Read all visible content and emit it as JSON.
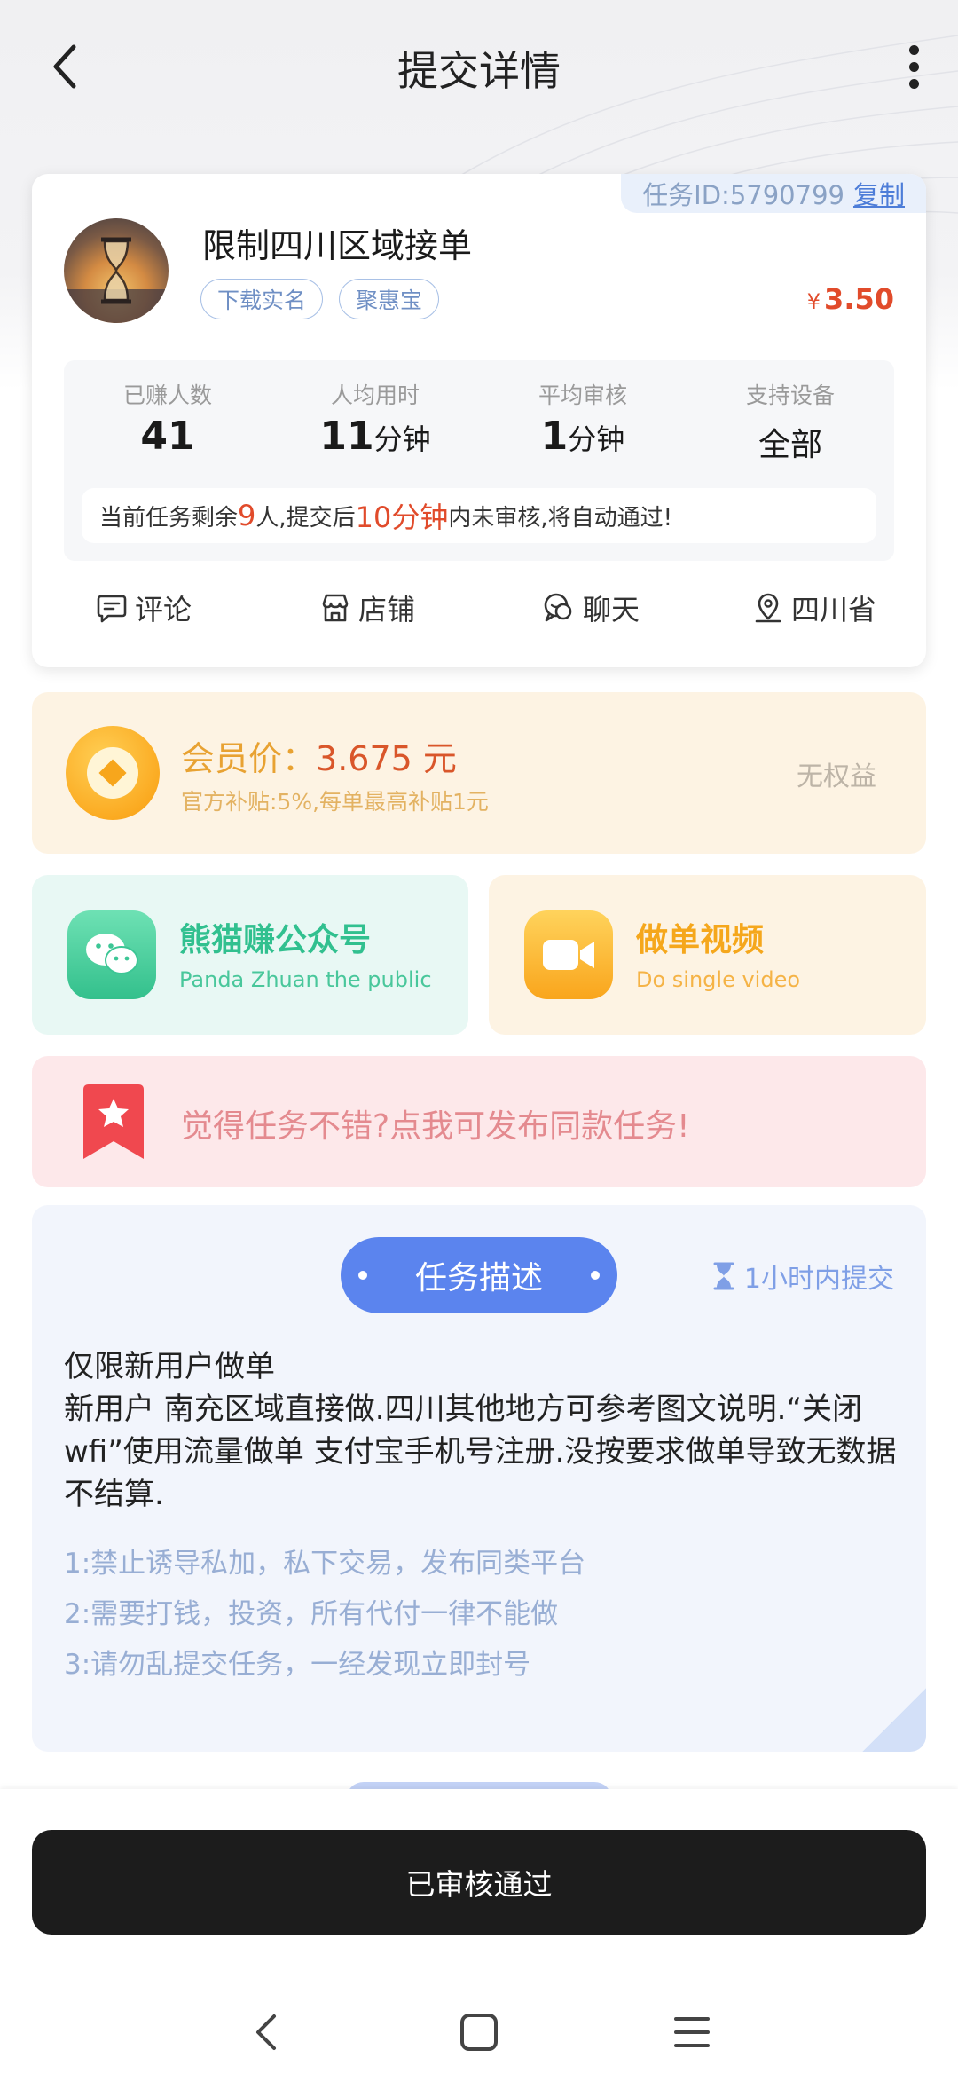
{
  "header": {
    "title": "提交详情"
  },
  "task": {
    "id_label": "任务ID:5790799",
    "copy_label": "复制",
    "title": "限制四川区域接单",
    "tags": [
      "下载实名",
      "聚惠宝"
    ],
    "currency": "¥",
    "price": "3.50",
    "stats": [
      {
        "label": "已赚人数",
        "value": "41",
        "unit": ""
      },
      {
        "label": "人均用时",
        "value": "11",
        "unit": "分钟"
      },
      {
        "label": "平均审核",
        "value": "1",
        "unit": "分钟"
      },
      {
        "label": "支持设备",
        "value": "全部",
        "unit": ""
      }
    ],
    "notice": {
      "part1": "当前任务剩余",
      "remaining": "9",
      "part2": "人,提交后",
      "minutes": "10分钟",
      "part3": "内未审核,将自动通过!"
    },
    "actions": [
      "评论",
      "店铺",
      "聊天",
      "四川省"
    ]
  },
  "member": {
    "label": "会员价：",
    "price": "3.675 元",
    "subsidy": "官方补贴:5%,每单最高补贴1元",
    "rights": "无权益"
  },
  "promos": {
    "wechat": {
      "title": "熊猫赚公众号",
      "subtitle": "Panda Zhuan the public"
    },
    "video": {
      "title": "做单视频",
      "subtitle": "Do single video"
    }
  },
  "publish": {
    "text": "觉得任务不错?点我可发布同款任务!"
  },
  "description": {
    "title": "任务描述",
    "deadline": "1小时内提交",
    "body": [
      "仅限新用户做单",
      "新用户 南充区域直接做.四川其他地方可参考图文说明.“关闭wfi”使用流量做单 支付宝手机号注册.没按要求做单导致无数据不结算."
    ],
    "rules": [
      "1:禁止诱导私加，私下交易，发布同类平台",
      "2:需要打钱，投资，所有代付一律不能做",
      "3:请勿乱提交任务，一经发现立即封号"
    ]
  },
  "status_button": "已审核通过",
  "colors": {
    "accent": "#5b84ee",
    "price": "#e14b2b",
    "member": "#e8a232",
    "dark_button": "#1c1c1c"
  },
  "icons": [
    "back-icon",
    "more-icon",
    "comment-icon",
    "store-icon",
    "chat-icon",
    "location-icon",
    "coin-icon",
    "wechat-icon",
    "video-icon",
    "bookmark-star-icon",
    "hourglass-icon"
  ]
}
